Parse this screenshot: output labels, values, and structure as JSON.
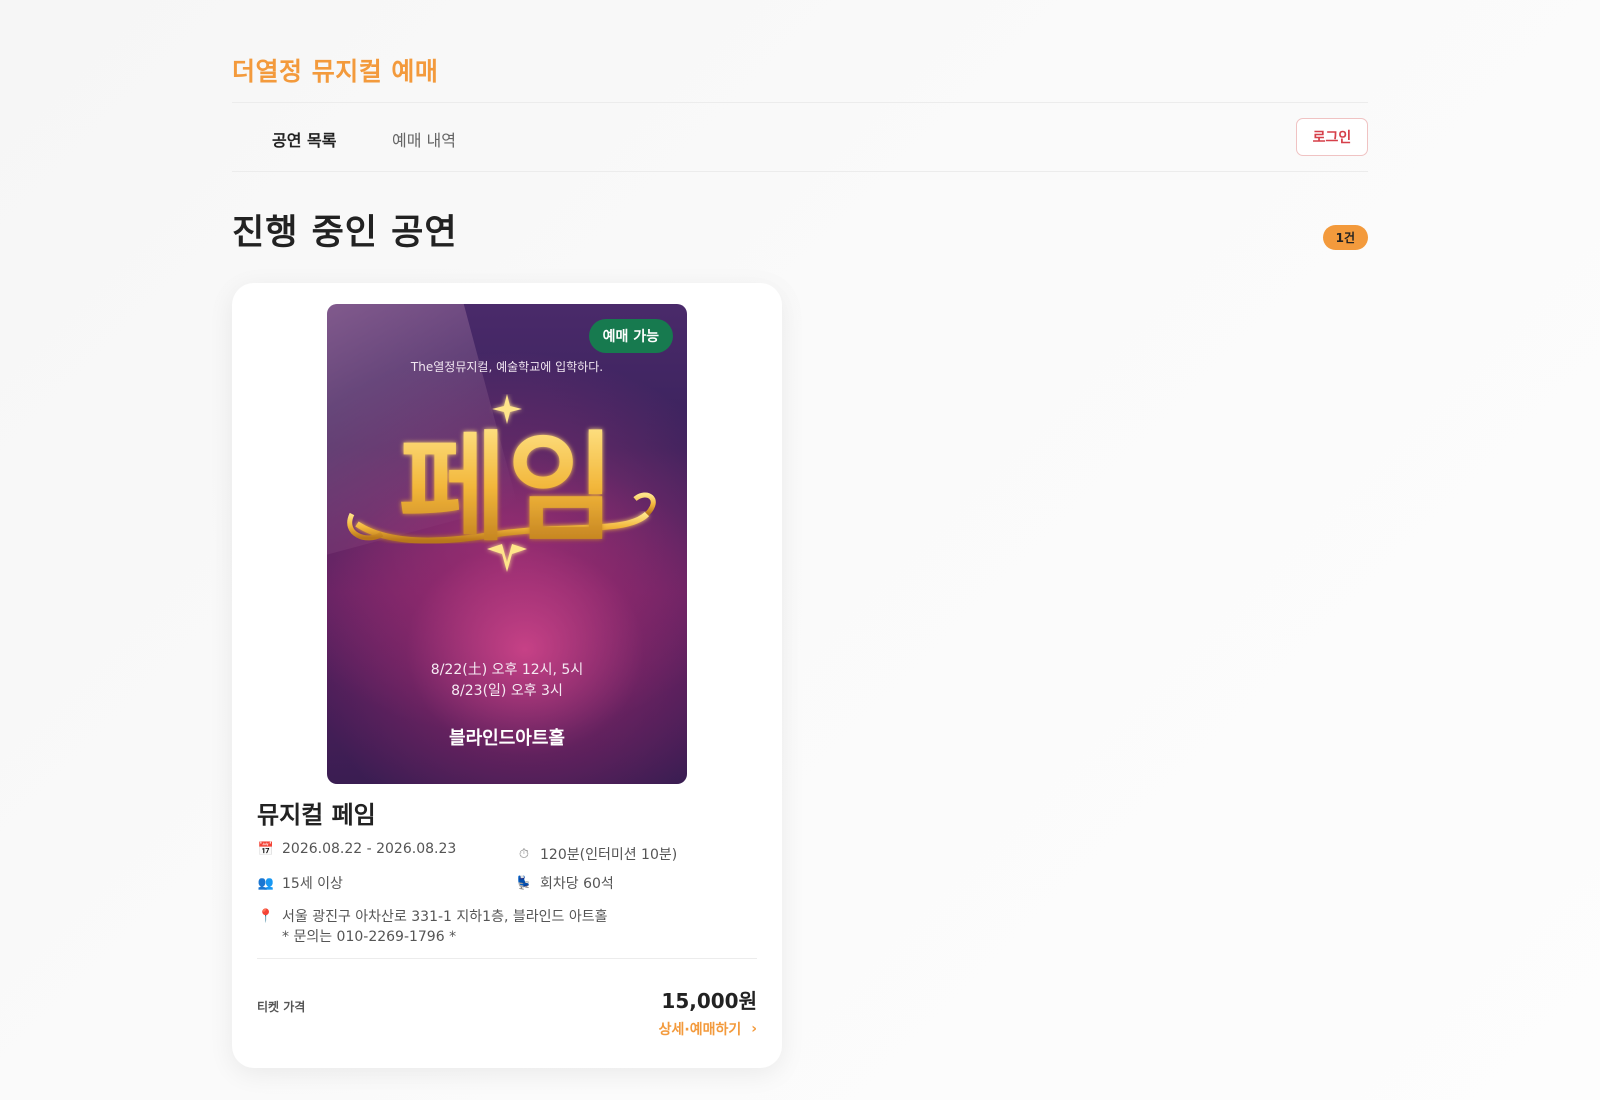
{
  "brand": "더열정 뮤지컬 예매",
  "nav": {
    "tabs": [
      {
        "label": "공연 목록",
        "active": true
      },
      {
        "label": "예매 내역",
        "active": false
      }
    ],
    "login_label": "로그인"
  },
  "section": {
    "title": "진행 중인 공연",
    "count_badge": "1건"
  },
  "card": {
    "status_badge": "예매 가능",
    "poster": {
      "tagline": "The열정뮤지컬, 예술학교에 입학하다.",
      "logo_text": "페임",
      "dates_line1": "8/22(土) 오후 12시, 5시",
      "dates_line2": "8/23(일) 오후 3시",
      "venue": "블라인드아트홀"
    },
    "title": "뮤지컬 페임",
    "period": "2026.08.22 - 2026.08.23",
    "runtime": "120분(인터미션 10분)",
    "age": "15세 이상",
    "seats": "회차당 60석",
    "address": "서울 광진구 아차산로 331-1 지하1층, 블라인드 아트홀",
    "contact": "* 문의는 010-2269-1796 *",
    "price_label": "티켓 가격",
    "price": "15,000원",
    "detail_link": "상세·예매하기"
  },
  "icons": {
    "calendar": "calendar-icon",
    "clock": "clock-icon",
    "people": "people-icon",
    "seat": "seat-icon",
    "pin": "location-pin-icon",
    "chevron": "chevron-right-icon"
  },
  "colors": {
    "accent": "#f39a3c",
    "login_text": "#d6404a",
    "status_green": "#177a4f"
  }
}
